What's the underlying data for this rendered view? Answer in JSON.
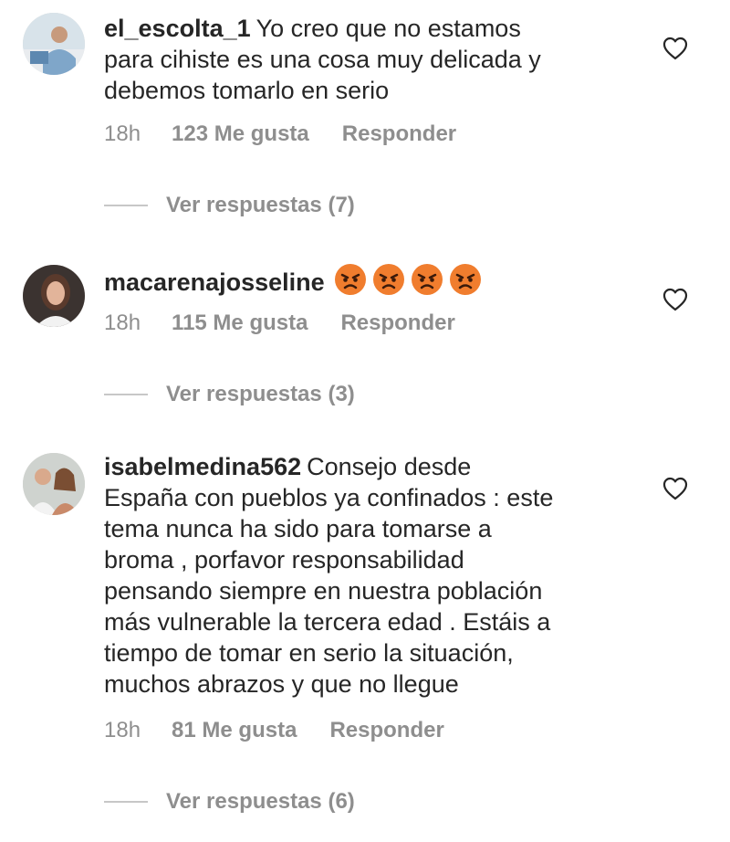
{
  "comments": [
    {
      "username": "el_escolta_1",
      "text": "Yo creo que no estamos\npara cihiste es una cosa muy delicada y\ndebemos tomarlo en serio",
      "time": "18h",
      "likes": "123 Me gusta",
      "reply_label": "Responder",
      "view_replies": "Ver respuestas (7)",
      "emojis": []
    },
    {
      "username": "macarenajosseline",
      "text": "",
      "time": "18h",
      "likes": "115 Me gusta",
      "reply_label": "Responder",
      "view_replies": "Ver respuestas (3)",
      "emojis": [
        "angry-face",
        "angry-face",
        "angry-face",
        "angry-face"
      ]
    },
    {
      "username": "isabelmedina562",
      "text": "Consejo desde\nEspaña con pueblos ya confinados : este\ntema nunca ha sido para tomarse a\nbroma , porfavor responsabilidad\npensando siempre en nuestra población\nmás vulnerable la tercera edad . Estáis a\ntiempo de tomar en serio la situación,\nmuchos abrazos y que no llegue",
      "time": "18h",
      "likes": "81 Me gusta",
      "reply_label": "Responder",
      "view_replies": "Ver respuestas (6)",
      "emojis": []
    }
  ],
  "icons": {
    "like": "heart-outline-icon",
    "emoji": "angry-face"
  },
  "colors": {
    "text": "#262626",
    "secondary": "#8e8e8e",
    "divider": "#c7c7c7",
    "emoji": "#f07d2e"
  }
}
